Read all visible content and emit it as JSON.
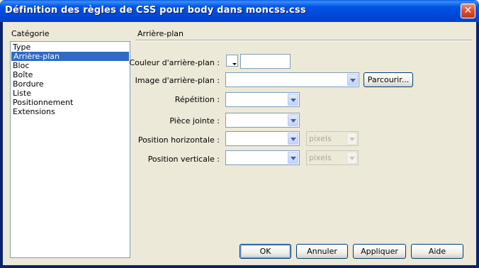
{
  "window": {
    "title": "Définition des règles de CSS pour body dans moncss.css",
    "close_symbol": "✕"
  },
  "category": {
    "label": "Catégorie",
    "items": [
      "Type",
      "Arrière-plan",
      "Bloc",
      "Boîte",
      "Bordure",
      "Liste",
      "Positionnement",
      "Extensions"
    ],
    "selected": "Arrière-plan"
  },
  "section": {
    "title": "Arrière-plan"
  },
  "fields": {
    "bg_color_label": "Couleur d'arrière-plan :",
    "bg_color_value": "",
    "bg_image_label": "Image d'arrière-plan :",
    "bg_image_value": "",
    "browse_label": "Parcourir...",
    "repeat_label": "Répétition :",
    "attachment_label": "Pièce jointe :",
    "hpos_label": "Position horizontale :",
    "hpos_unit": "pixels",
    "vpos_label": "Position verticale :",
    "vpos_unit": "pixels"
  },
  "buttons": {
    "ok": "OK",
    "cancel": "Annuler",
    "apply": "Appliquer",
    "help": "Aide"
  },
  "icons": {
    "swatch": "color-swatch-icon",
    "dropdown": "chevron-down-icon"
  }
}
